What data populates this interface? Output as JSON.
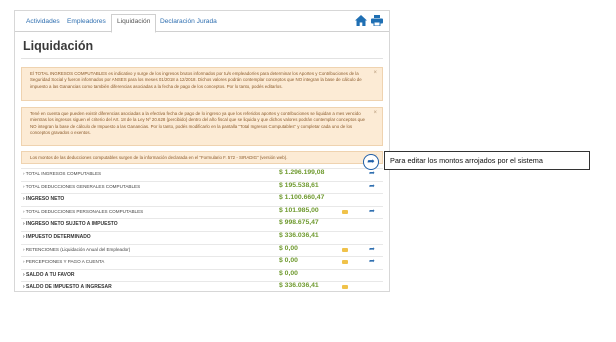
{
  "tabs": [
    "Actividades",
    "Empleadores",
    "Liquidación",
    "Declaración Jurada"
  ],
  "icons": {
    "home": "home-icon",
    "print": "print-icon",
    "share": "share-icon",
    "envelope": "envelope-icon",
    "close": "close-icon"
  },
  "page_title": "Liquidación",
  "alerts": [
    "El TOTAL INGRESOS COMPUTABLES es indicativo y surge de los ingresos brutos informados por tu/s empleador/es para determinar los Aportes y Contribuciones de la Seguridad Social y fueron informados por ANSES para los meses 01/2018 a 12/2018. Dichos valores podrán contemplar conceptos que NO integran la base de cálculo de impuesto a las Ganancias como también diferencias asociadas a la fecha de pago de los conceptos. Por lo tanto, podés editarlos.",
    "Tené en cuenta que pueden existir diferencias asociadas a la efectiva fecha de pago de lo ingreso ya que los referidos aportes y contribuciones se liquidan a mes vencido mientras los ingresos siguen el criterio del Art. 18 de la Ley Nº 20.628 (percibido) dentro del año fiscal que se liquida y que dichos valores podrán contemplar conceptos que NO integran la base de cálculo de Impuesto a las Ganancias. Por lo tanto, podés modificarlo en la pantalla \"Total Ingresos Computables\" y completar cada uno de los conceptos gravados o exentos.",
    "Los montos de las deducciones computables surgen de la información declarada en el \"Formulario F. 572 - SIRADIG\" (versión web)."
  ],
  "close_glyph": "×",
  "rows": [
    {
      "label": "TOTAL INGRESOS COMPUTABLES",
      "value": "$ 1.296.199,08",
      "bold": false,
      "env": false,
      "share": true
    },
    {
      "label": "TOTAL DEDUCCIONES GENERALES COMPUTABLES",
      "value": "$ 195.538,61",
      "bold": false,
      "env": false,
      "share": true
    },
    {
      "label": "INGRESO NETO",
      "value": "$ 1.100.660,47",
      "bold": true,
      "env": false,
      "share": false
    },
    {
      "label": "TOTAL DEDUCCIONES PERSONALES COMPUTABLES",
      "value": "$ 101.985,00",
      "bold": false,
      "env": true,
      "share": true
    },
    {
      "label": "INGRESO NETO SUJETO A IMPUESTO",
      "value": "$ 998.675,47",
      "bold": true,
      "env": false,
      "share": false
    },
    {
      "label": "IMPUESTO DETERMINADO",
      "value": "$ 336.036,41",
      "bold": true,
      "env": false,
      "share": false
    },
    {
      "label": "RETENCIONES (Liquidación Anual del Empleador)",
      "value": "$ 0,00",
      "bold": false,
      "env": true,
      "share": true
    },
    {
      "label": "PERCEPCIONES Y PAGO A CUENTA",
      "value": "$ 0,00",
      "bold": false,
      "env": true,
      "share": true
    },
    {
      "label": "SALDO A TU FAVOR",
      "value": "$ 0,00",
      "bold": true,
      "env": false,
      "share": false
    },
    {
      "label": "SALDO DE IMPUESTO A INGRESAR",
      "value": "$ 336.036,41",
      "bold": true,
      "env": true,
      "share": false
    }
  ],
  "callout": "Para editar los montos arrojados por el sistema"
}
